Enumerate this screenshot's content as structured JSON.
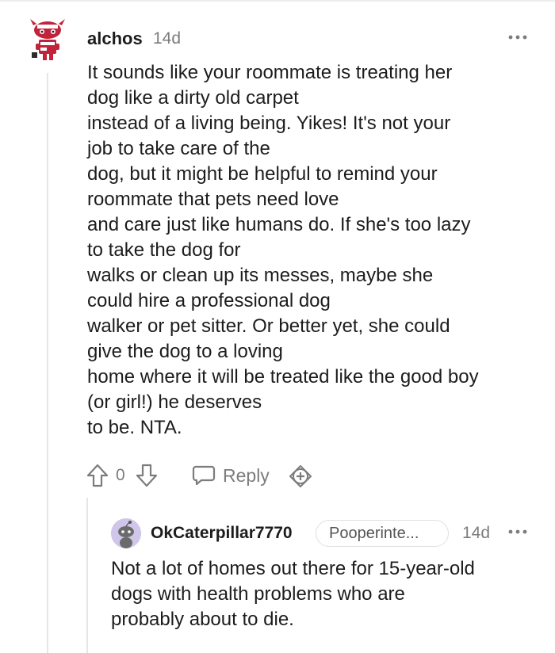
{
  "comment": {
    "author": "alchos",
    "age": "14d",
    "body_lines": [
      "It sounds like your roommate is treating her",
      "dog like a dirty old carpet",
      "instead of a living being. Yikes! It's not your",
      "job to take care of the",
      "dog, but it might be helpful to remind your",
      "roommate that pets need love",
      "and care just like humans do. If she's too lazy",
      "to take the dog for",
      "walks or clean up its messes, maybe she",
      "could hire a professional dog",
      "walker or pet sitter. Or better yet, she could",
      "give the dog to a loving",
      "home where it will be treated like the good boy",
      "(or girl!) he deserves",
      "to be. NTA."
    ],
    "score": "0",
    "reply_label": "Reply"
  },
  "reply": {
    "author": "OkCaterpillar7770",
    "flair": "Pooperinte...",
    "age": "14d",
    "body_lines": [
      "Not a lot of homes out there for 15-year-old",
      "dogs with health problems who are",
      "probably about to die."
    ]
  },
  "colors": {
    "meta_gray": "#7c7c7c",
    "text": "#1c1c1c",
    "thread_line": "#e6e6e6",
    "avatar_red": "#c2233b",
    "reply_avatar_bg": "#cfc6ea"
  },
  "icons": {
    "main_avatar": "snoo-avatar-red-mug",
    "more": "more-dots-icon",
    "upvote": "upvote-arrow-icon",
    "downvote": "downvote-arrow-icon",
    "reply": "speech-bubble-icon",
    "award": "award-plus-icon",
    "reply_avatar": "snoo-avatar-purple"
  }
}
